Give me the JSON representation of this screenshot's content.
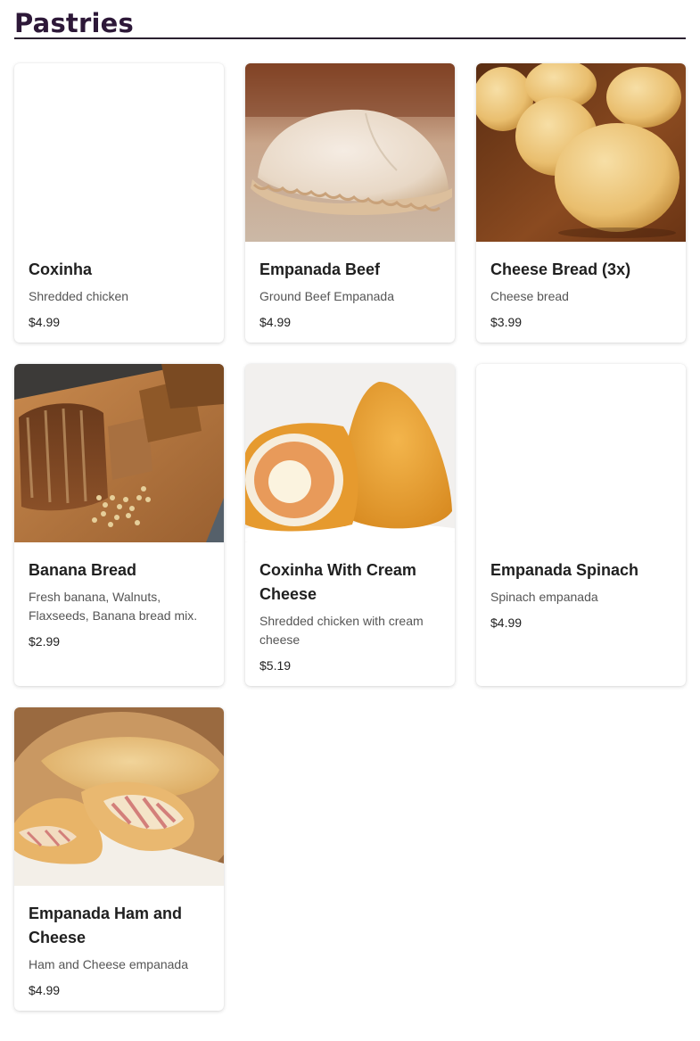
{
  "section": {
    "title": "Pastries"
  },
  "products": [
    {
      "name": "Coxinha",
      "description": "Shredded chicken",
      "price": "$4.99",
      "image": "none"
    },
    {
      "name": "Empanada Beef",
      "description": "Ground Beef Empanada",
      "price": "$4.99",
      "image": "beef-empanada-photo"
    },
    {
      "name": "Cheese Bread (3x)",
      "description": "Cheese bread",
      "price": "$3.99",
      "image": "cheese-bread-photo"
    },
    {
      "name": "Banana Bread",
      "description": "Fresh banana, Walnuts, Flaxseeds, Banana bread mix.",
      "price": "$2.99",
      "image": "banana-bread-photo"
    },
    {
      "name": "Coxinha With Cream Cheese",
      "description": "Shredded chicken with cream cheese",
      "price": "$5.19",
      "image": "coxinha-cream-cheese-photo"
    },
    {
      "name": "Empanada Spinach",
      "description": "Spinach empanada",
      "price": "$4.99",
      "image": "none"
    },
    {
      "name": "Empanada Ham and Cheese",
      "description": "Ham and Cheese empanada",
      "price": "$4.99",
      "image": "ham-cheese-empanada-photo"
    }
  ],
  "colors": {
    "title": "#2d1838",
    "divider": "#2a2030",
    "name": "#1f1f1f",
    "description": "#555555",
    "price": "#222222"
  }
}
